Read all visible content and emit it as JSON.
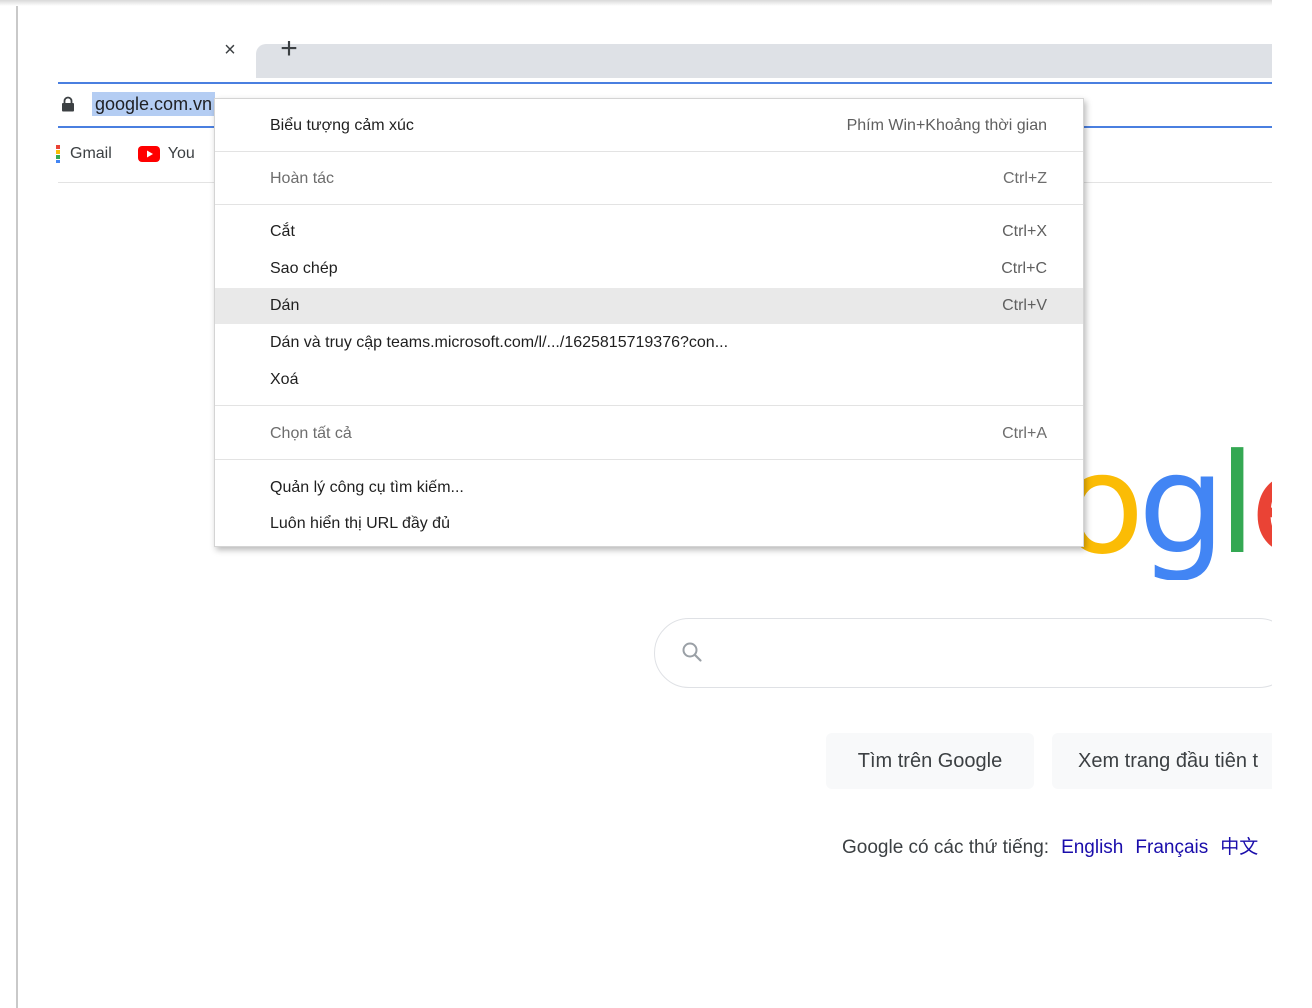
{
  "browser": {
    "tab_close": "×",
    "new_tab": "+",
    "url": "google.com.vn"
  },
  "bookmarks": [
    {
      "label": "Gmail"
    },
    {
      "label": "You"
    }
  ],
  "google_page": {
    "logo_letters": [
      "o",
      "g",
      "l",
      "e"
    ],
    "search_button": "Tìm trên Google",
    "lucky_button": "Xem trang đầu tiên t",
    "languages_prefix": "Google có các thứ tiếng:",
    "languages": [
      "English",
      "Français",
      "中文"
    ]
  },
  "context_menu": {
    "items": [
      {
        "label": "Biểu tượng cảm xúc",
        "shortcut": "Phím Win+Khoảng thời gian"
      },
      {
        "label": "Hoàn tác",
        "shortcut": "Ctrl+Z"
      },
      {
        "label": "Cắt",
        "shortcut": "Ctrl+X"
      },
      {
        "label": "Sao chép",
        "shortcut": "Ctrl+C"
      },
      {
        "label": "Dán",
        "shortcut": "Ctrl+V"
      },
      {
        "label": "Dán và truy cập teams.microsoft.com/l/.../1625815719376?con...",
        "shortcut": ""
      },
      {
        "label": "Xoá",
        "shortcut": ""
      },
      {
        "label": "Chọn tất cả",
        "shortcut": "Ctrl+A"
      },
      {
        "label": "Quản lý công cụ tìm kiếm...",
        "shortcut": ""
      },
      {
        "label": "Luôn hiển thị URL đầy đủ",
        "shortcut": ""
      }
    ]
  },
  "colors": {
    "accent_blue": "#4a7fe0",
    "google_blue": "#4285f4",
    "google_red": "#ea4335",
    "google_yellow": "#fbbc05",
    "google_green": "#34a853"
  }
}
